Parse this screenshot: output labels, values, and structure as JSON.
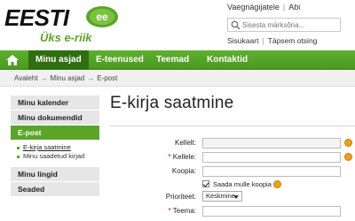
{
  "logo": {
    "word": "EESTI",
    "mark_text": "ee",
    "tagline": "Üks e-riik"
  },
  "header": {
    "top_links": [
      "Vaegnägijatele",
      "Abi"
    ],
    "search_placeholder": "Sisesta märksõna...",
    "sub_links": [
      "Sisukaart",
      "Täpsem otsing"
    ]
  },
  "nav": {
    "home_icon": "home-icon",
    "items": [
      "Minu asjad",
      "E-teenused",
      "Teemad",
      "Kontaktid"
    ],
    "active_index": 0
  },
  "breadcrumb": [
    "Avaleht",
    "Minu asjad",
    "E-post"
  ],
  "sidebar": {
    "items": [
      "Minu kalender",
      "Minu dokumendid",
      "E-post",
      "Minu lingid",
      "Seaded"
    ],
    "active": "E-post",
    "subitems": [
      "E-kirja saatmine",
      "Minu saadetud kirjad"
    ]
  },
  "main": {
    "title": "E-kirja saatmine",
    "form": {
      "from_label": "Kellelt:",
      "to_label": "Kellele:",
      "cc_label": "Koopia:",
      "copy_me_label": "Saada mulle koopia",
      "copy_me_checked": true,
      "priority_label": "Prioriteet:",
      "priority_value": "Keskmine",
      "subject_label": "Teema:"
    }
  },
  "colors": {
    "brand_green": "#5aa528",
    "nav_active": "#2f6e12",
    "help_icon": "#e9a21a"
  }
}
